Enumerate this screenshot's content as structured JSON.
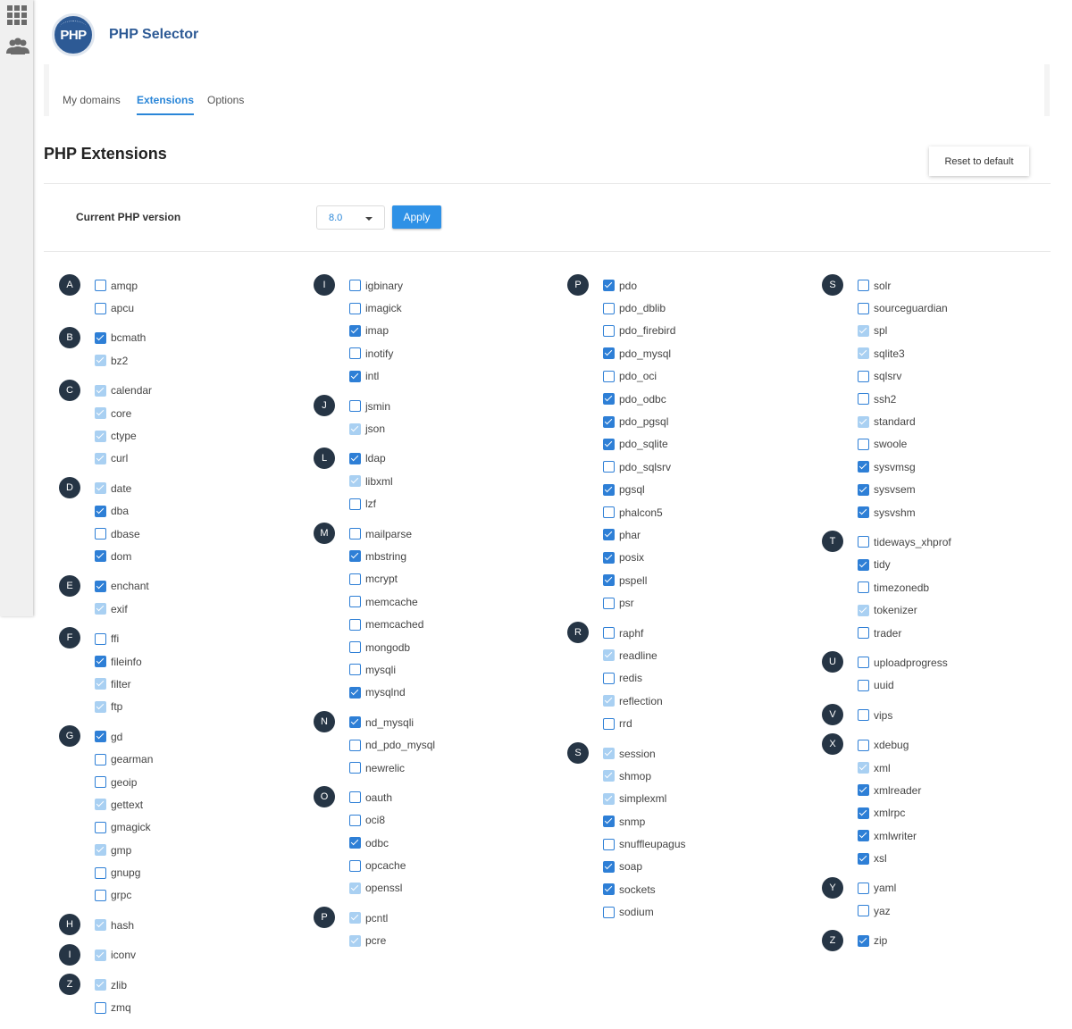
{
  "app": {
    "title": "PHP Selector",
    "logo_text": "PHP"
  },
  "tabs": [
    {
      "label": "My domains",
      "active": false
    },
    {
      "label": "Extensions",
      "active": true
    },
    {
      "label": "Options",
      "active": false
    }
  ],
  "section_title": "PHP Extensions",
  "reset_label": "Reset to default",
  "version": {
    "label": "Current PHP version",
    "value": "8.0",
    "apply_label": "Apply"
  },
  "colors": {
    "accent": "#2e7fd6",
    "builtin": "#a9d0f2",
    "badge": "#263545",
    "brand": "#2d5a95"
  },
  "columns": [
    [
      {
        "letter": "A",
        "items": [
          {
            "name": "amqp",
            "state": "off"
          },
          {
            "name": "apcu",
            "state": "off"
          }
        ]
      },
      {
        "letter": "B",
        "items": [
          {
            "name": "bcmath",
            "state": "on"
          },
          {
            "name": "bz2",
            "state": "builtin"
          }
        ]
      },
      {
        "letter": "C",
        "items": [
          {
            "name": "calendar",
            "state": "builtin"
          },
          {
            "name": "core",
            "state": "builtin"
          },
          {
            "name": "ctype",
            "state": "builtin"
          },
          {
            "name": "curl",
            "state": "builtin"
          }
        ]
      },
      {
        "letter": "D",
        "items": [
          {
            "name": "date",
            "state": "builtin"
          },
          {
            "name": "dba",
            "state": "on"
          },
          {
            "name": "dbase",
            "state": "off"
          },
          {
            "name": "dom",
            "state": "on"
          }
        ]
      },
      {
        "letter": "E",
        "items": [
          {
            "name": "enchant",
            "state": "on"
          },
          {
            "name": "exif",
            "state": "builtin"
          }
        ]
      },
      {
        "letter": "F",
        "items": [
          {
            "name": "ffi",
            "state": "off"
          },
          {
            "name": "fileinfo",
            "state": "on"
          },
          {
            "name": "filter",
            "state": "builtin"
          },
          {
            "name": "ftp",
            "state": "builtin"
          }
        ]
      },
      {
        "letter": "G",
        "items": [
          {
            "name": "gd",
            "state": "on"
          },
          {
            "name": "gearman",
            "state": "off"
          },
          {
            "name": "geoip",
            "state": "off"
          },
          {
            "name": "gettext",
            "state": "builtin"
          },
          {
            "name": "gmagick",
            "state": "off"
          },
          {
            "name": "gmp",
            "state": "builtin"
          },
          {
            "name": "gnupg",
            "state": "off"
          },
          {
            "name": "grpc",
            "state": "off"
          }
        ]
      },
      {
        "letter": "H",
        "items": [
          {
            "name": "hash",
            "state": "builtin"
          }
        ]
      },
      {
        "letter": "I",
        "items": [
          {
            "name": "iconv",
            "state": "builtin"
          }
        ]
      },
      {
        "letter": "Z",
        "items": [
          {
            "name": "zlib",
            "state": "builtin"
          },
          {
            "name": "zmq",
            "state": "off"
          }
        ]
      }
    ],
    [
      {
        "letter": "I",
        "items": [
          {
            "name": "igbinary",
            "state": "off"
          },
          {
            "name": "imagick",
            "state": "off"
          },
          {
            "name": "imap",
            "state": "on"
          },
          {
            "name": "inotify",
            "state": "off"
          },
          {
            "name": "intl",
            "state": "on"
          }
        ]
      },
      {
        "letter": "J",
        "items": [
          {
            "name": "jsmin",
            "state": "off"
          },
          {
            "name": "json",
            "state": "builtin"
          }
        ]
      },
      {
        "letter": "L",
        "items": [
          {
            "name": "ldap",
            "state": "on"
          },
          {
            "name": "libxml",
            "state": "builtin"
          },
          {
            "name": "lzf",
            "state": "off"
          }
        ]
      },
      {
        "letter": "M",
        "items": [
          {
            "name": "mailparse",
            "state": "off"
          },
          {
            "name": "mbstring",
            "state": "on"
          },
          {
            "name": "mcrypt",
            "state": "off"
          },
          {
            "name": "memcache",
            "state": "off"
          },
          {
            "name": "memcached",
            "state": "off"
          },
          {
            "name": "mongodb",
            "state": "off"
          },
          {
            "name": "mysqli",
            "state": "off"
          },
          {
            "name": "mysqlnd",
            "state": "on"
          }
        ]
      },
      {
        "letter": "N",
        "items": [
          {
            "name": "nd_mysqli",
            "state": "on"
          },
          {
            "name": "nd_pdo_mysql",
            "state": "off"
          },
          {
            "name": "newrelic",
            "state": "off"
          }
        ]
      },
      {
        "letter": "O",
        "items": [
          {
            "name": "oauth",
            "state": "off"
          },
          {
            "name": "oci8",
            "state": "off"
          },
          {
            "name": "odbc",
            "state": "on"
          },
          {
            "name": "opcache",
            "state": "off"
          },
          {
            "name": "openssl",
            "state": "builtin"
          }
        ]
      },
      {
        "letter": "P",
        "items": [
          {
            "name": "pcntl",
            "state": "builtin"
          },
          {
            "name": "pcre",
            "state": "builtin"
          }
        ]
      }
    ],
    [
      {
        "letter": "P",
        "items": [
          {
            "name": "pdo",
            "state": "on"
          },
          {
            "name": "pdo_dblib",
            "state": "off"
          },
          {
            "name": "pdo_firebird",
            "state": "off"
          },
          {
            "name": "pdo_mysql",
            "state": "on"
          },
          {
            "name": "pdo_oci",
            "state": "off"
          },
          {
            "name": "pdo_odbc",
            "state": "on"
          },
          {
            "name": "pdo_pgsql",
            "state": "on"
          },
          {
            "name": "pdo_sqlite",
            "state": "on"
          },
          {
            "name": "pdo_sqlsrv",
            "state": "off"
          },
          {
            "name": "pgsql",
            "state": "on"
          },
          {
            "name": "phalcon5",
            "state": "off"
          },
          {
            "name": "phar",
            "state": "on"
          },
          {
            "name": "posix",
            "state": "on"
          },
          {
            "name": "pspell",
            "state": "on"
          },
          {
            "name": "psr",
            "state": "off"
          }
        ]
      },
      {
        "letter": "R",
        "items": [
          {
            "name": "raphf",
            "state": "off"
          },
          {
            "name": "readline",
            "state": "builtin"
          },
          {
            "name": "redis",
            "state": "off"
          },
          {
            "name": "reflection",
            "state": "builtin"
          },
          {
            "name": "rrd",
            "state": "off"
          }
        ]
      },
      {
        "letter": "S",
        "items": [
          {
            "name": "session",
            "state": "builtin"
          },
          {
            "name": "shmop",
            "state": "builtin"
          },
          {
            "name": "simplexml",
            "state": "builtin"
          },
          {
            "name": "snmp",
            "state": "on"
          },
          {
            "name": "snuffleupagus",
            "state": "off"
          },
          {
            "name": "soap",
            "state": "on"
          },
          {
            "name": "sockets",
            "state": "on"
          },
          {
            "name": "sodium",
            "state": "off"
          }
        ]
      }
    ],
    [
      {
        "letter": "S",
        "items": [
          {
            "name": "solr",
            "state": "off"
          },
          {
            "name": "sourceguardian",
            "state": "off"
          },
          {
            "name": "spl",
            "state": "builtin"
          },
          {
            "name": "sqlite3",
            "state": "builtin"
          },
          {
            "name": "sqlsrv",
            "state": "off"
          },
          {
            "name": "ssh2",
            "state": "off"
          },
          {
            "name": "standard",
            "state": "builtin"
          },
          {
            "name": "swoole",
            "state": "off"
          },
          {
            "name": "sysvmsg",
            "state": "on"
          },
          {
            "name": "sysvsem",
            "state": "on"
          },
          {
            "name": "sysvshm",
            "state": "on"
          }
        ]
      },
      {
        "letter": "T",
        "items": [
          {
            "name": "tideways_xhprof",
            "state": "off"
          },
          {
            "name": "tidy",
            "state": "on"
          },
          {
            "name": "timezonedb",
            "state": "off"
          },
          {
            "name": "tokenizer",
            "state": "builtin"
          },
          {
            "name": "trader",
            "state": "off"
          }
        ]
      },
      {
        "letter": "U",
        "items": [
          {
            "name": "uploadprogress",
            "state": "off"
          },
          {
            "name": "uuid",
            "state": "off"
          }
        ]
      },
      {
        "letter": "V",
        "items": [
          {
            "name": "vips",
            "state": "off"
          }
        ]
      },
      {
        "letter": "X",
        "items": [
          {
            "name": "xdebug",
            "state": "off"
          },
          {
            "name": "xml",
            "state": "builtin"
          },
          {
            "name": "xmlreader",
            "state": "on"
          },
          {
            "name": "xmlrpc",
            "state": "on"
          },
          {
            "name": "xmlwriter",
            "state": "on"
          },
          {
            "name": "xsl",
            "state": "on"
          }
        ]
      },
      {
        "letter": "Y",
        "items": [
          {
            "name": "yaml",
            "state": "off"
          },
          {
            "name": "yaz",
            "state": "off"
          }
        ]
      },
      {
        "letter": "Z",
        "items": [
          {
            "name": "zip",
            "state": "on"
          }
        ]
      }
    ]
  ]
}
